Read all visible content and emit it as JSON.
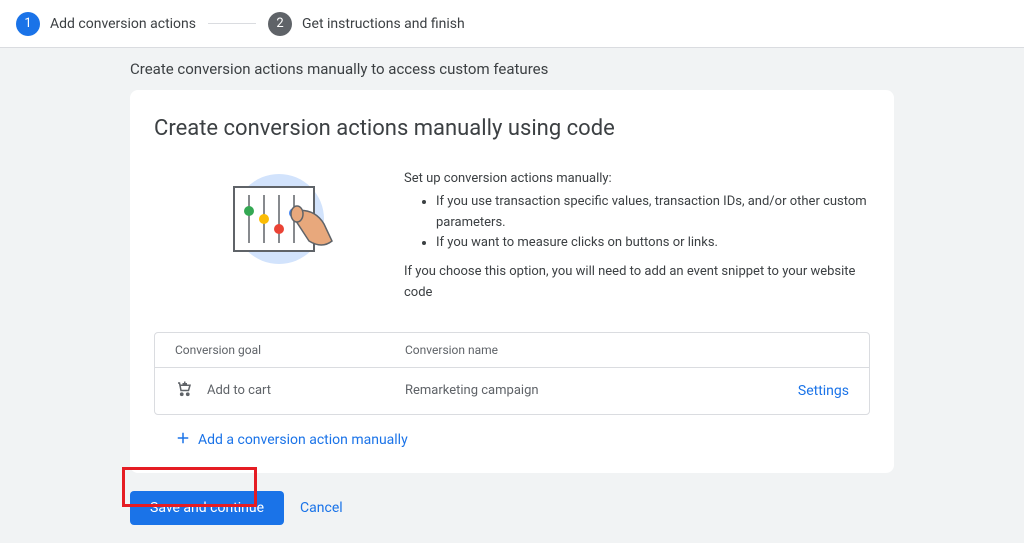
{
  "stepper": {
    "steps": [
      {
        "num": "1",
        "label": "Add conversion actions",
        "active": true
      },
      {
        "num": "2",
        "label": "Get instructions and finish",
        "active": false
      }
    ]
  },
  "subtitle": "Create conversion actions manually to access custom features",
  "card": {
    "title": "Create conversion actions manually using code",
    "intro_lead": "Set up conversion actions manually:",
    "bullets": [
      "If you use transaction specific values, transaction IDs, and/or other custom parameters.",
      "If you want to measure clicks on buttons or links."
    ],
    "intro_note": "If you choose this option, you will need to add an event snippet to your website code",
    "table": {
      "headers": {
        "goal": "Conversion goal",
        "name": "Conversion name"
      },
      "rows": [
        {
          "goal": "Add to cart",
          "name": "Remarketing campaign",
          "action": "Settings"
        }
      ]
    },
    "add_link": "Add a conversion action manually"
  },
  "footer": {
    "primary": "Save and continue",
    "cancel": "Cancel"
  }
}
